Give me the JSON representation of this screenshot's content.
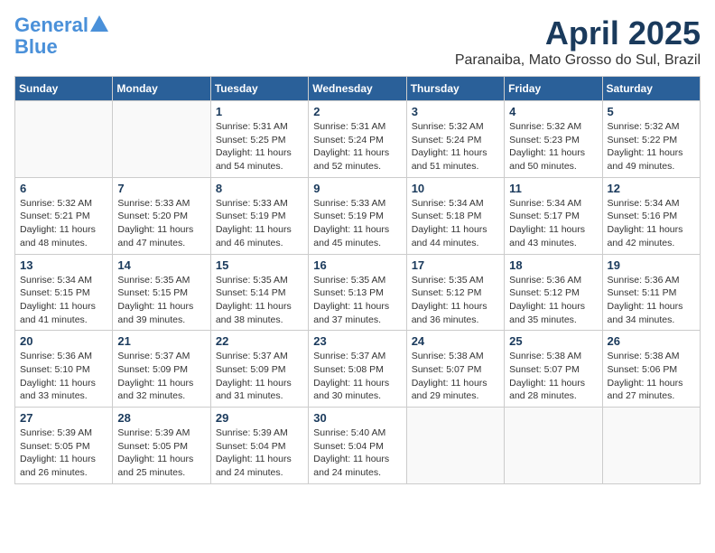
{
  "logo": {
    "line1": "General",
    "line2": "Blue"
  },
  "title": "April 2025",
  "location": "Paranaiba, Mato Grosso do Sul, Brazil",
  "days_of_week": [
    "Sunday",
    "Monday",
    "Tuesday",
    "Wednesday",
    "Thursday",
    "Friday",
    "Saturday"
  ],
  "weeks": [
    [
      {
        "day": "",
        "info": ""
      },
      {
        "day": "",
        "info": ""
      },
      {
        "day": "1",
        "info": "Sunrise: 5:31 AM\nSunset: 5:25 PM\nDaylight: 11 hours and 54 minutes."
      },
      {
        "day": "2",
        "info": "Sunrise: 5:31 AM\nSunset: 5:24 PM\nDaylight: 11 hours and 52 minutes."
      },
      {
        "day": "3",
        "info": "Sunrise: 5:32 AM\nSunset: 5:24 PM\nDaylight: 11 hours and 51 minutes."
      },
      {
        "day": "4",
        "info": "Sunrise: 5:32 AM\nSunset: 5:23 PM\nDaylight: 11 hours and 50 minutes."
      },
      {
        "day": "5",
        "info": "Sunrise: 5:32 AM\nSunset: 5:22 PM\nDaylight: 11 hours and 49 minutes."
      }
    ],
    [
      {
        "day": "6",
        "info": "Sunrise: 5:32 AM\nSunset: 5:21 PM\nDaylight: 11 hours and 48 minutes."
      },
      {
        "day": "7",
        "info": "Sunrise: 5:33 AM\nSunset: 5:20 PM\nDaylight: 11 hours and 47 minutes."
      },
      {
        "day": "8",
        "info": "Sunrise: 5:33 AM\nSunset: 5:19 PM\nDaylight: 11 hours and 46 minutes."
      },
      {
        "day": "9",
        "info": "Sunrise: 5:33 AM\nSunset: 5:19 PM\nDaylight: 11 hours and 45 minutes."
      },
      {
        "day": "10",
        "info": "Sunrise: 5:34 AM\nSunset: 5:18 PM\nDaylight: 11 hours and 44 minutes."
      },
      {
        "day": "11",
        "info": "Sunrise: 5:34 AM\nSunset: 5:17 PM\nDaylight: 11 hours and 43 minutes."
      },
      {
        "day": "12",
        "info": "Sunrise: 5:34 AM\nSunset: 5:16 PM\nDaylight: 11 hours and 42 minutes."
      }
    ],
    [
      {
        "day": "13",
        "info": "Sunrise: 5:34 AM\nSunset: 5:15 PM\nDaylight: 11 hours and 41 minutes."
      },
      {
        "day": "14",
        "info": "Sunrise: 5:35 AM\nSunset: 5:15 PM\nDaylight: 11 hours and 39 minutes."
      },
      {
        "day": "15",
        "info": "Sunrise: 5:35 AM\nSunset: 5:14 PM\nDaylight: 11 hours and 38 minutes."
      },
      {
        "day": "16",
        "info": "Sunrise: 5:35 AM\nSunset: 5:13 PM\nDaylight: 11 hours and 37 minutes."
      },
      {
        "day": "17",
        "info": "Sunrise: 5:35 AM\nSunset: 5:12 PM\nDaylight: 11 hours and 36 minutes."
      },
      {
        "day": "18",
        "info": "Sunrise: 5:36 AM\nSunset: 5:12 PM\nDaylight: 11 hours and 35 minutes."
      },
      {
        "day": "19",
        "info": "Sunrise: 5:36 AM\nSunset: 5:11 PM\nDaylight: 11 hours and 34 minutes."
      }
    ],
    [
      {
        "day": "20",
        "info": "Sunrise: 5:36 AM\nSunset: 5:10 PM\nDaylight: 11 hours and 33 minutes."
      },
      {
        "day": "21",
        "info": "Sunrise: 5:37 AM\nSunset: 5:09 PM\nDaylight: 11 hours and 32 minutes."
      },
      {
        "day": "22",
        "info": "Sunrise: 5:37 AM\nSunset: 5:09 PM\nDaylight: 11 hours and 31 minutes."
      },
      {
        "day": "23",
        "info": "Sunrise: 5:37 AM\nSunset: 5:08 PM\nDaylight: 11 hours and 30 minutes."
      },
      {
        "day": "24",
        "info": "Sunrise: 5:38 AM\nSunset: 5:07 PM\nDaylight: 11 hours and 29 minutes."
      },
      {
        "day": "25",
        "info": "Sunrise: 5:38 AM\nSunset: 5:07 PM\nDaylight: 11 hours and 28 minutes."
      },
      {
        "day": "26",
        "info": "Sunrise: 5:38 AM\nSunset: 5:06 PM\nDaylight: 11 hours and 27 minutes."
      }
    ],
    [
      {
        "day": "27",
        "info": "Sunrise: 5:39 AM\nSunset: 5:05 PM\nDaylight: 11 hours and 26 minutes."
      },
      {
        "day": "28",
        "info": "Sunrise: 5:39 AM\nSunset: 5:05 PM\nDaylight: 11 hours and 25 minutes."
      },
      {
        "day": "29",
        "info": "Sunrise: 5:39 AM\nSunset: 5:04 PM\nDaylight: 11 hours and 24 minutes."
      },
      {
        "day": "30",
        "info": "Sunrise: 5:40 AM\nSunset: 5:04 PM\nDaylight: 11 hours and 24 minutes."
      },
      {
        "day": "",
        "info": ""
      },
      {
        "day": "",
        "info": ""
      },
      {
        "day": "",
        "info": ""
      }
    ]
  ]
}
